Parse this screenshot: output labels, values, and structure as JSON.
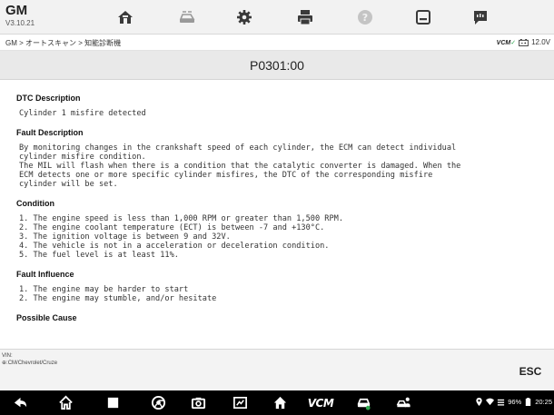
{
  "app": {
    "make": "GM",
    "version": "V3.10.21"
  },
  "toolbar": {
    "buttons": [
      {
        "name": "home",
        "icon": "home-icon"
      },
      {
        "name": "vehicle-swap",
        "icon": "vehicle-swap-icon"
      },
      {
        "name": "settings",
        "icon": "gear-icon"
      },
      {
        "name": "print",
        "icon": "printer-icon"
      },
      {
        "name": "help",
        "icon": "help-icon"
      },
      {
        "name": "save",
        "icon": "save-icon"
      },
      {
        "name": "datalogging",
        "icon": "chat-icon"
      }
    ]
  },
  "breadcrumb": "GM > オートスキャン > 知能診断機",
  "vcm_status": {
    "vcm": "VCM",
    "voltage": "12.0V"
  },
  "page": {
    "title": "P0301:00"
  },
  "sections": [
    {
      "title": "DTC Description",
      "lines": [
        "Cylinder 1 misfire detected"
      ]
    },
    {
      "title": "Fault Description",
      "lines": [
        "By monitoring changes in the crankshaft speed of each cylinder, the ECM can detect individual",
        "cylinder misfire condition.",
        "The MIL will flash when there is a condition that the catalytic converter is damaged. When the",
        "ECM detects one or more specific cylinder misfires, the DTC of the corresponding misfire",
        "cylinder will be set."
      ]
    },
    {
      "title": "Condition",
      "lines": [
        "1. The engine speed is less than 1,000 RPM or greater than 1,500 RPM.",
        "2. The engine coolant temperature (ECT) is between -7 and +130°C.",
        "3. The ignition voltage is between 9 and 32V.",
        "4. The vehicle is not in a acceleration or deceleration condition.",
        "5. The fuel level is at least 11%."
      ]
    },
    {
      "title": "Fault Influence",
      "lines": [
        "1. The engine may be harder to start",
        "2. The engine may stumble, and/or hesitate"
      ]
    },
    {
      "title": "Possible Cause",
      "lines": []
    }
  ],
  "vehicle_info": {
    "vin_label": "VIN:",
    "path": "⊕:CM/Chevrolet/Cruze"
  },
  "esc_label": "ESC",
  "navbar": {
    "buttons": [
      "back-icon",
      "home-icon",
      "recent-apps-icon",
      "browser-icon",
      "camera-icon",
      "screenshot-icon",
      "maxisys-home-icon",
      "vcm-icon",
      "vehicle-menu-icon",
      "shop-manager-icon"
    ],
    "vcm_label": "VCM"
  },
  "statusbar": {
    "battery": "96%",
    "time": "20:25"
  },
  "colors": {
    "accent_green": "#2fa84f",
    "toolbar_bg": "#f2f2f2",
    "navbar_bg": "#000000"
  }
}
